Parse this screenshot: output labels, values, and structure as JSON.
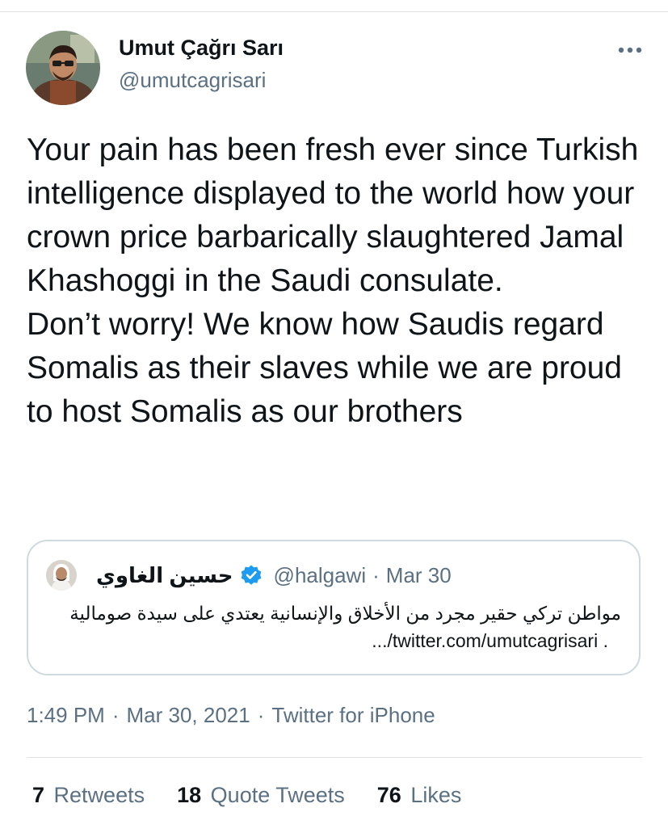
{
  "author": {
    "name": "Umut Çağrı Sarı",
    "handle": "@umutcagrisari"
  },
  "tweet": {
    "paragraphs": [
      "Your pain has been fresh ever since Turkish intelligence displayed to the world how your crown price barbarically slaughtered Jamal Khashoggi in the Saudi consulate.",
      "Don’t worry! We know how Saudis regard Somalis as their slaves while we are proud to host Somalis as our brothers"
    ]
  },
  "quoted_tweet": {
    "name": "حسين الغاوي",
    "handle": "@halgawi",
    "separator": "·",
    "date": "Mar 30",
    "text_line_1": "مواطن تركي حقير مجرد من الأخلاق والإنسانية يعتدي على سيدة صومالية",
    "text_line_2": ".../twitter.com/umutcagrisari ."
  },
  "meta": {
    "time": "1:49 PM",
    "separator": "·",
    "date": "Mar 30, 2021",
    "source": "Twitter for iPhone"
  },
  "stats": {
    "retweets_count": "7",
    "retweets_label": "Retweets",
    "quote_tweets_count": "18",
    "quote_tweets_label": "Quote Tweets",
    "likes_count": "76",
    "likes_label": "Likes"
  },
  "colors": {
    "text_primary": "#0f1419",
    "text_secondary": "#5b7083",
    "border": "#cfd9de",
    "verified_blue": "#1d9bf0"
  },
  "icons": {
    "more": "more-horizontal-icon",
    "verified": "verified-badge-icon"
  }
}
